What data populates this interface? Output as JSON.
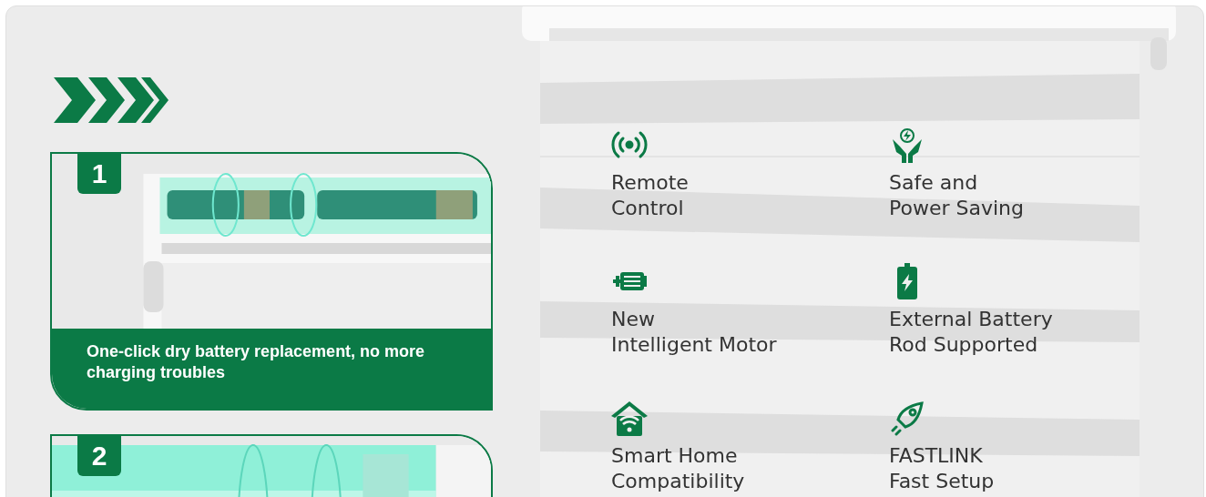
{
  "steps": [
    {
      "number": "1",
      "kind": "battery",
      "caption": "One-click dry battery replacement, no more charging troubles"
    },
    {
      "number": "2",
      "kind": "motor"
    }
  ],
  "features": [
    {
      "kind": "remote",
      "text": "Remote\nControl"
    },
    {
      "kind": "hands",
      "text": "Safe and\nPower Saving"
    },
    {
      "kind": "motor",
      "text": "New\nIntelligent Motor"
    },
    {
      "kind": "battery",
      "text": "External Battery\nRod Supported"
    },
    {
      "kind": "home",
      "text": "Smart Home\nCompatibility"
    },
    {
      "kind": "rocket",
      "text": "FASTLINK\nFast Setup"
    }
  ]
}
